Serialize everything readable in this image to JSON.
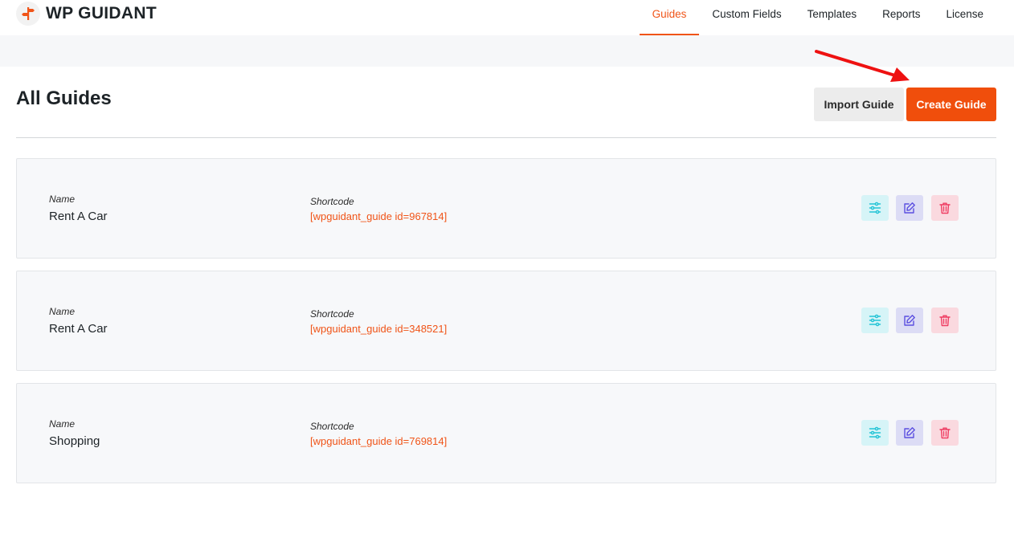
{
  "brand": {
    "name": "WP GUIDANT",
    "accent": "#f05418"
  },
  "nav": [
    {
      "label": "Guides",
      "active": true
    },
    {
      "label": "Custom Fields",
      "active": false
    },
    {
      "label": "Templates",
      "active": false
    },
    {
      "label": "Reports",
      "active": false
    },
    {
      "label": "License",
      "active": false
    }
  ],
  "page": {
    "title": "All Guides",
    "import_label": "Import Guide",
    "create_label": "Create Guide"
  },
  "guides": [
    {
      "name_label": "Name",
      "name": "Rent A Car",
      "shortcode_label": "Shortcode",
      "shortcode": "[wpguidant_guide id=967814]"
    },
    {
      "name_label": "Name",
      "name": "Rent A Car",
      "shortcode_label": "Shortcode",
      "shortcode": "[wpguidant_guide id=348521]"
    },
    {
      "name_label": "Name",
      "name": "Shopping",
      "shortcode_label": "Shortcode",
      "shortcode": "[wpguidant_guide id=769814]"
    }
  ],
  "icons": {
    "settings": "sliders-icon",
    "edit": "edit-icon",
    "delete": "trash-icon",
    "annotation": "red-arrow"
  },
  "colors": {
    "create_button": "#f04e0c",
    "settings_icon": "#22c3d6",
    "edit_icon": "#5b4fe0",
    "delete_icon": "#ef3e63",
    "annotation_arrow": "#ee1111"
  }
}
